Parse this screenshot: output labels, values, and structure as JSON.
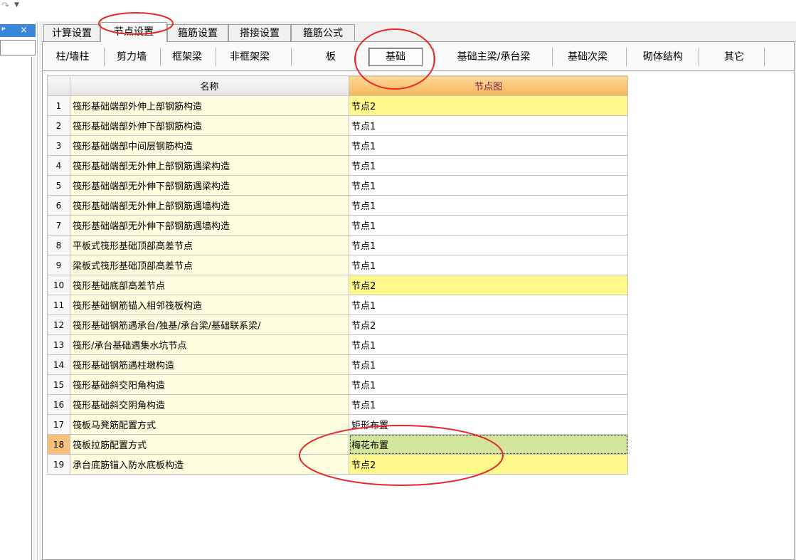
{
  "top": {
    "redo_icon": "redo-icon",
    "dropdown_icon": "dropdown-arrow-icon"
  },
  "left_panel": {
    "pin_glyph": "ᴾ",
    "close_glyph": "×"
  },
  "tabs": [
    {
      "label": "计算设置"
    },
    {
      "label": "节点设置",
      "active": true
    },
    {
      "label": "箍筋设置"
    },
    {
      "label": "搭接设置"
    },
    {
      "label": "箍筋公式"
    }
  ],
  "subtabs": [
    {
      "label": "柱/墙柱"
    },
    {
      "label": "剪力墙"
    },
    {
      "label": "框架梁"
    },
    {
      "label": "非框架梁"
    },
    {
      "label": "板"
    },
    {
      "label": "基础",
      "selected": true
    },
    {
      "label": "基础主梁/承台梁"
    },
    {
      "label": "基础次梁"
    },
    {
      "label": "砌体结构"
    },
    {
      "label": "其它"
    }
  ],
  "table": {
    "columns": [
      "名称",
      "节点图"
    ],
    "rows": [
      {
        "no": "1",
        "name": "筏形基础端部外伸上部钢筋构造",
        "value": "节点2"
      },
      {
        "no": "2",
        "name": "筏形基础端部外伸下部钢筋构造",
        "value": "节点1"
      },
      {
        "no": "3",
        "name": "筏形基础端部中间层钢筋构造",
        "value": "节点1"
      },
      {
        "no": "4",
        "name": "筏形基础端部无外伸上部钢筋遇梁构造",
        "value": "节点1"
      },
      {
        "no": "5",
        "name": "筏形基础端部无外伸下部钢筋遇梁构造",
        "value": "节点1"
      },
      {
        "no": "6",
        "name": "筏形基础端部无外伸上部钢筋遇墙构造",
        "value": "节点1"
      },
      {
        "no": "7",
        "name": "筏形基础端部无外伸下部钢筋遇墙构造",
        "value": "节点1"
      },
      {
        "no": "8",
        "name": "平板式筏形基础顶部高差节点",
        "value": "节点1"
      },
      {
        "no": "9",
        "name": "梁板式筏形基础顶部高差节点",
        "value": "节点1"
      },
      {
        "no": "10",
        "name": "筏形基础底部高差节点",
        "value": "节点2"
      },
      {
        "no": "11",
        "name": "筏形基础钢筋锚入相邻筏板构造",
        "value": "节点1"
      },
      {
        "no": "12",
        "name": "筏形基础钢筋遇承台/独基/承台梁/基础联系梁/",
        "value": "节点2"
      },
      {
        "no": "13",
        "name": "筏形/承台基础遇集水坑节点",
        "value": "节点1"
      },
      {
        "no": "14",
        "name": "筏形基础钢筋遇柱墩构造",
        "value": "节点1"
      },
      {
        "no": "15",
        "name": "筏形基础斜交阳角构造",
        "value": "节点1"
      },
      {
        "no": "16",
        "name": "筏形基础斜交阴角构造",
        "value": "节点1"
      },
      {
        "no": "17",
        "name": "筏板马凳筋配置方式",
        "value": "矩形布置"
      },
      {
        "no": "18",
        "name": "筏板拉筋配置方式",
        "value": "梅花布置"
      },
      {
        "no": "19",
        "name": "承台底筋锚入防水底板构造",
        "value": "节点2"
      }
    ]
  },
  "colors": {
    "highlight_yellow": "#fff88a",
    "selected_green": "#d2e59a",
    "name_cell": "#ffffdf",
    "header_orange": "#f3b65a",
    "selected_row_index": "#f8c07a",
    "annotation_red": "#e8282a"
  }
}
